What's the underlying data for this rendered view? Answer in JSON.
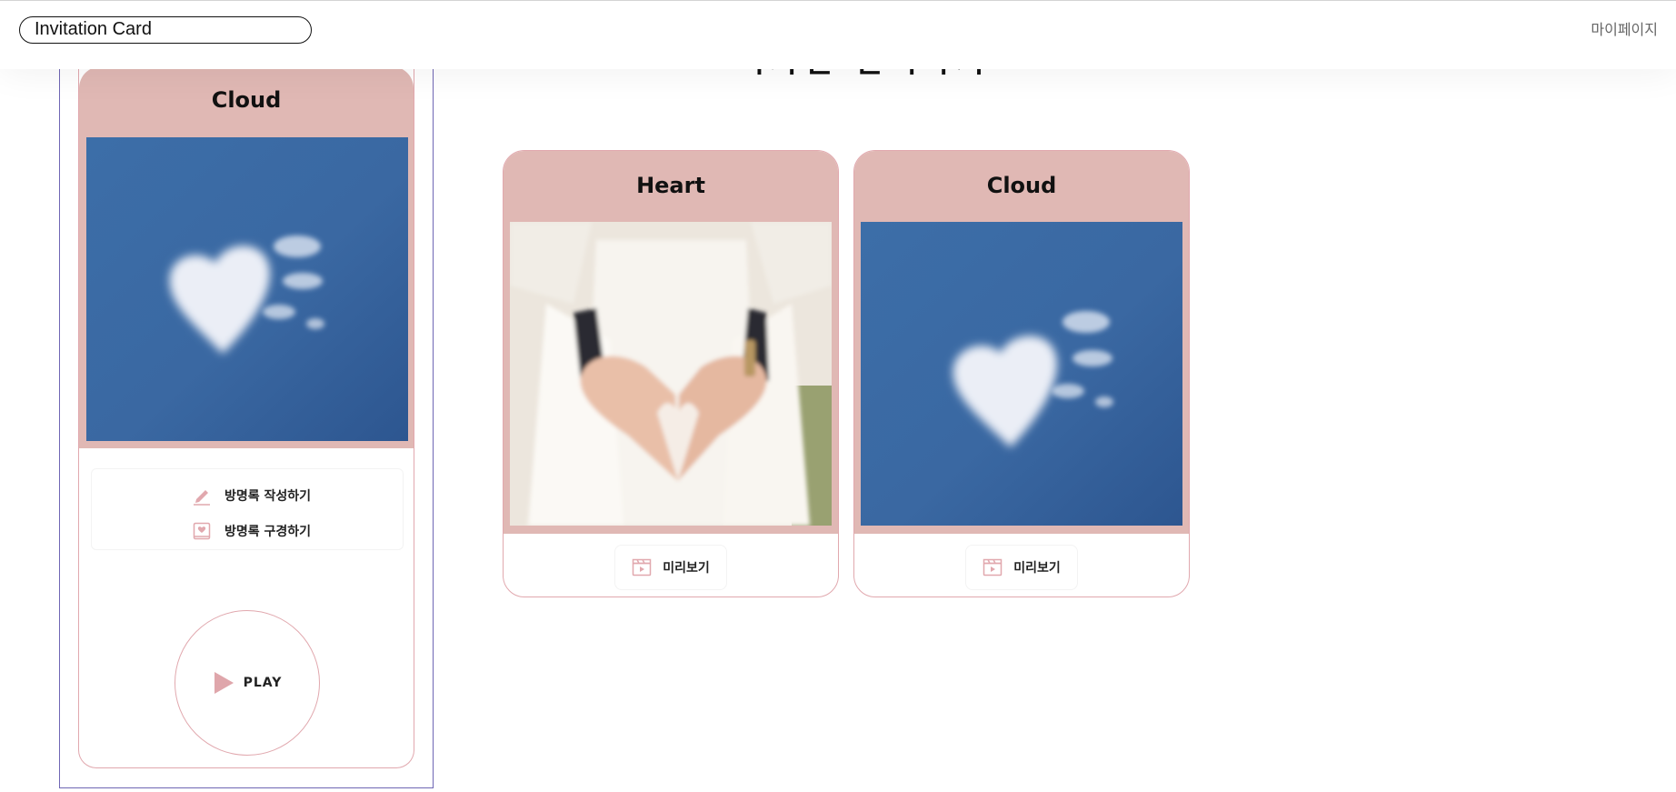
{
  "header": {
    "logo": "Invitation Card",
    "mypage": "마이페이지"
  },
  "page": {
    "heading": "디자인 선택하기"
  },
  "phone_preview": {
    "title": "Cloud",
    "image": "heart-shaped-cloud-photo",
    "guestbook": [
      {
        "label": "방명록 작성하기",
        "icon": "pen-icon"
      },
      {
        "label": "방명록 구경하기",
        "icon": "guestbook-icon"
      }
    ],
    "play_label": "PLAY"
  },
  "templates": [
    {
      "title": "Heart",
      "image": "couple-heart-hands-photo",
      "preview_label": "미리보기"
    },
    {
      "title": "Cloud",
      "image": "heart-shaped-cloud-photo",
      "preview_label": "미리보기"
    }
  ],
  "colors": {
    "card_pink": "#e0b8b4",
    "border_pink": "#e1a8ae",
    "accent": "#d98f97",
    "phone_border": "#6f66b4",
    "sky": "#3a6aa6"
  }
}
